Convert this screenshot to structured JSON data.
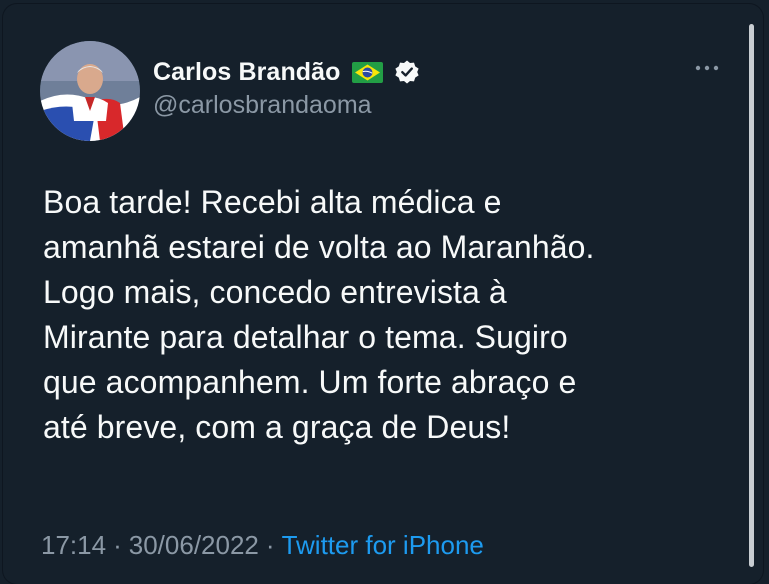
{
  "tweet": {
    "author": {
      "display_name": "Carlos Brandão",
      "handle": "@carlosbrandaoma",
      "flag_icon": "brazil-flag-icon",
      "verified_icon": "verified-badge-icon"
    },
    "more_icon": "more-options-icon",
    "text": "Boa tarde! Recebi alta médica e\namanhã estarei de volta ao Maranhão.\nLogo mais, concedo entrevista à\nMirante para detalhar o tema. Sugiro\nque acompanhem. Um forte abraço e\naté breve, com a graça de Deus!",
    "time": "17:14",
    "separator": "·",
    "date": "30/06/2022",
    "source": "Twitter for iPhone"
  },
  "colors": {
    "background": "#15202b",
    "text": "#f7f9f9",
    "secondary_text": "#8b98a5",
    "link": "#1d9bf0"
  }
}
